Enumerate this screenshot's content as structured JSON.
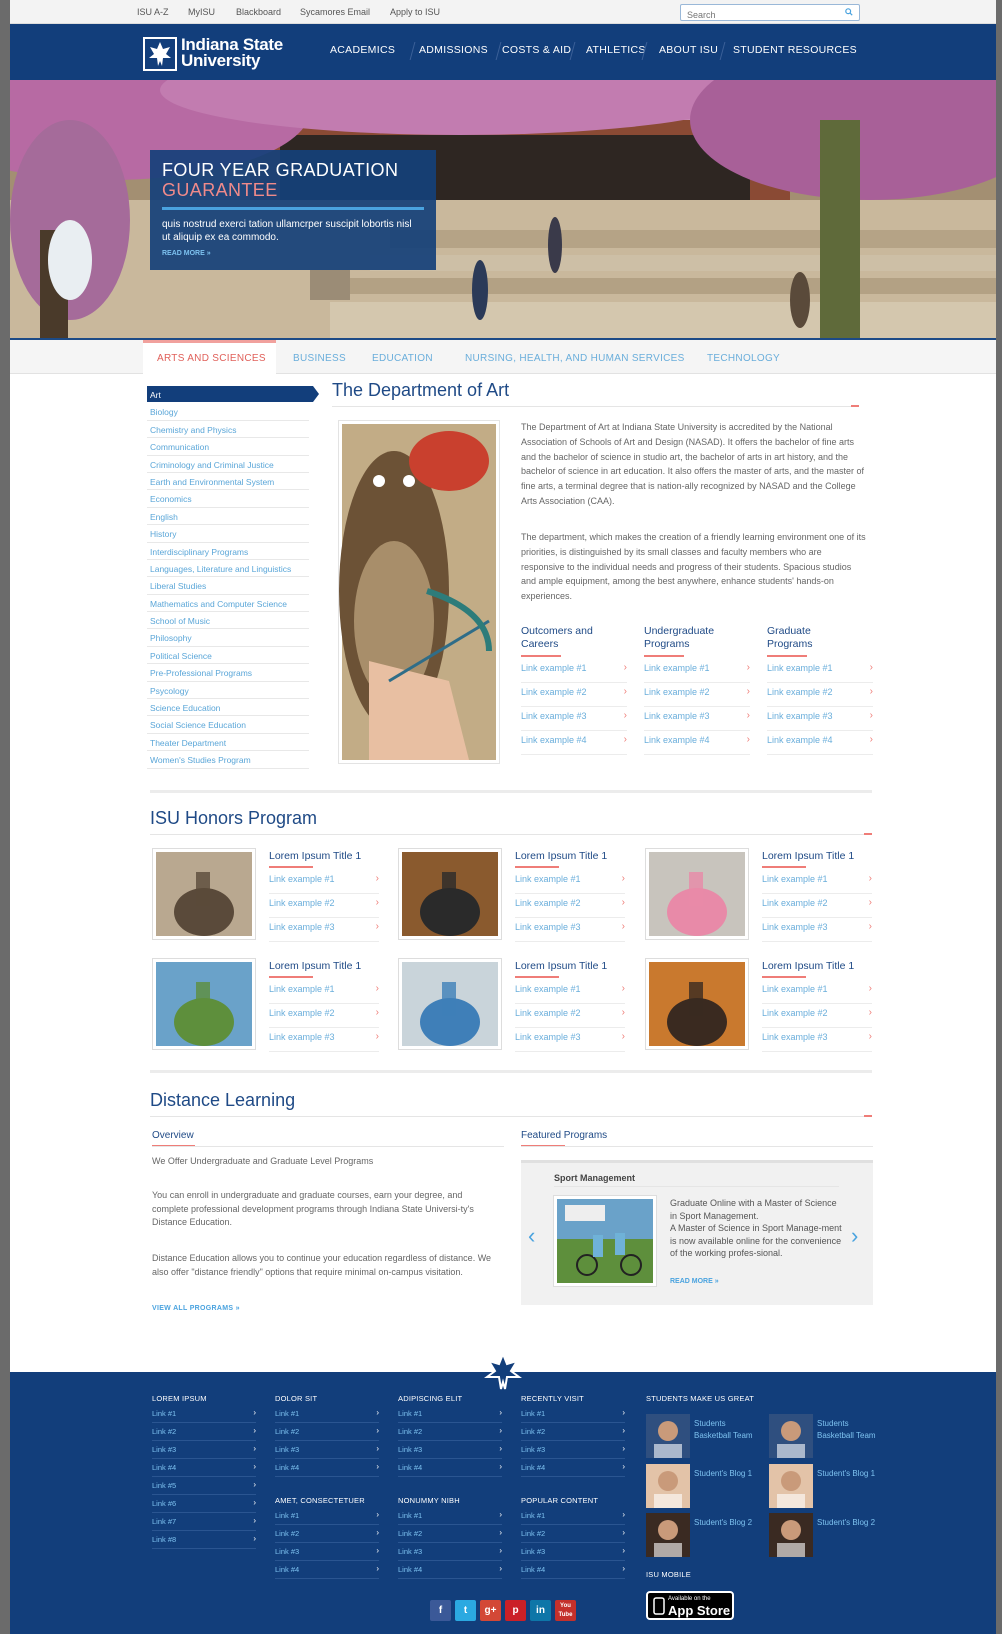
{
  "utility": {
    "links": [
      "ISU A-Z",
      "MyISU",
      "Blackboard",
      "Sycamores Email",
      "Apply to ISU"
    ],
    "search_placeholder": "Search"
  },
  "header": {
    "logo_line1": "Indiana State",
    "logo_line2": "University",
    "nav": [
      "ACADEMICS",
      "ADMISSIONS",
      "COSTS & AID",
      "ATHLETICS",
      "ABOUT ISU",
      "STUDENT RESOURCES"
    ]
  },
  "hero": {
    "title1": "FOUR YEAR GRADUATION",
    "title2": "GUARANTEE",
    "text": "quis nostrud exerci tation ullamcrper suscipit lobortis nisl ut aliquip ex ea commodo.",
    "more": "READ MORE »"
  },
  "tabs": [
    "ARTS AND SCIENCES",
    "BUSINESS",
    "EDUCATION",
    "NURSING, HEALTH, AND HUMAN SERVICES",
    "TECHNOLOGY"
  ],
  "sidebar": [
    "Art",
    "Biology",
    "Chemistry and Physics",
    "Communication",
    "Criminology and Criminal Justice",
    "Earth and Environmental System",
    "Economics",
    "English",
    "History",
    "Interdisciplinary Programs",
    "Languages, Literature and Linguistics",
    "Liberal Studies",
    "Mathematics and Computer Science",
    "School of Music",
    "Philosophy",
    "Political Science",
    "Pre-Professional Programs",
    "Psycology",
    "Science Education",
    "Social Science Education",
    "Theater Department",
    "Women's Studies Program"
  ],
  "dept": {
    "title": "The Department of Art",
    "p1": "The Department of Art at Indiana State University is accredited by the National Association of Schools of Art and Design (NASAD). It offers the bachelor of fine arts and the bachelor of science in studio art, the bachelor of arts in art history, and the bachelor of science in art education. It also offers the master of arts, and the master of fine arts, a terminal degree that is nation-ally recognized by NASAD and the College Arts Association (CAA).",
    "p2": "The department, which makes the creation of a friendly learning environment one of its priorities, is distinguished by its small classes and faculty members who are responsive to the individual needs and progress of their students. Spacious studios and ample equipment, among the best anywhere, enhance students' hands-on experiences.",
    "columns": [
      {
        "head1": "Outcomers and",
        "head2": "Careers",
        "links": [
          "Link example #1",
          "Link example #2",
          "Link example #3",
          "Link example #4"
        ]
      },
      {
        "head1": "Undergraduate",
        "head2": "Programs",
        "links": [
          "Link example #1",
          "Link example #2",
          "Link example #3",
          "Link example #4"
        ]
      },
      {
        "head1": "Graduate",
        "head2": "Programs",
        "links": [
          "Link example #1",
          "Link example #2",
          "Link example #3",
          "Link example #4"
        ]
      }
    ]
  },
  "honors": {
    "title": "ISU Honors Program",
    "cards": [
      {
        "title": "Lorem Ipsum Title 1",
        "links": [
          "Link example #1",
          "Link example #2",
          "Link example #3"
        ]
      },
      {
        "title": "Lorem Ipsum Title 1",
        "links": [
          "Link example #1",
          "Link example #2",
          "Link example #3"
        ]
      },
      {
        "title": "Lorem Ipsum Title 1",
        "links": [
          "Link example #1",
          "Link example #2",
          "Link example #3"
        ]
      },
      {
        "title": "Lorem Ipsum Title 1",
        "links": [
          "Link example #1",
          "Link example #2",
          "Link example #3"
        ]
      },
      {
        "title": "Lorem Ipsum Title 1",
        "links": [
          "Link example #1",
          "Link example #2",
          "Link example #3"
        ]
      },
      {
        "title": "Lorem Ipsum Title 1",
        "links": [
          "Link example #1",
          "Link example #2",
          "Link example #3"
        ]
      }
    ]
  },
  "distance": {
    "title": "Distance Learning",
    "overview": "Overview",
    "sub": "We Offer Undergraduate and Graduate Level Programs",
    "p1": "You can enroll in undergraduate and graduate courses, earn your degree, and complete professional development programs through Indiana State Universi-ty's Distance Education.",
    "p2": "Distance Education allows you to continue your education regardless of distance. We also offer \"distance friendly\" options that require minimal on-campus visitation.",
    "view_all": "VIEW ALL PROGRAMS »",
    "featured_head": "Featured Programs",
    "featured_title": "Sport Management",
    "featured_sub": "Graduate Online with a Master of Science in Sport Management.",
    "featured_text": "A Master of Science in Sport Manage-ment is now available online for the convenience of the working profes-sional.",
    "featured_more": "READ MORE »"
  },
  "footer": {
    "col1": {
      "head": "LOREM IPSUM",
      "links": [
        "Link #1",
        "Link #2",
        "Link #3",
        "Link #4",
        "Link #5",
        "Link #6",
        "Link #7",
        "Link #8"
      ]
    },
    "col2": {
      "head": "DOLOR SIT",
      "links": [
        "Link #1",
        "Link #2",
        "Link #3",
        "Link #4"
      ],
      "head2": "AMET, CONSECTETUER",
      "links2": [
        "Link #1",
        "Link #2",
        "Link #3",
        "Link #4"
      ]
    },
    "col3": {
      "head": "ADIPISCING ELIT",
      "links": [
        "Link #1",
        "Link #2",
        "Link #3",
        "Link #4"
      ],
      "head2": "NONUMMY NIBH",
      "links2": [
        "Link #1",
        "Link #2",
        "Link #3",
        "Link #4"
      ]
    },
    "col4": {
      "head": "RECENTLY VISIT",
      "links": [
        "Link #1",
        "Link #2",
        "Link #3",
        "Link #4"
      ],
      "head2": "POPULAR CONTENT",
      "links2": [
        "Link #1",
        "Link #2",
        "Link #3",
        "Link #4"
      ]
    },
    "students_head": "STUDENTS MAKE US GREAT",
    "students": [
      "Students Basketball Team",
      "Students Basketball Team",
      "Student's Blog 1",
      "Student's Blog 1",
      "Student's Blog 2",
      "Student's Blog 2"
    ],
    "mobile_head": "ISU MOBILE",
    "app_line1": "Available on the",
    "app_line2": "App Store",
    "social": [
      "f",
      "t",
      "g+",
      "p",
      "in",
      "You Tube"
    ]
  },
  "colors": {
    "navy": "#123e7b",
    "accent_red": "#ef7d78",
    "link_blue": "#6aaedb"
  }
}
